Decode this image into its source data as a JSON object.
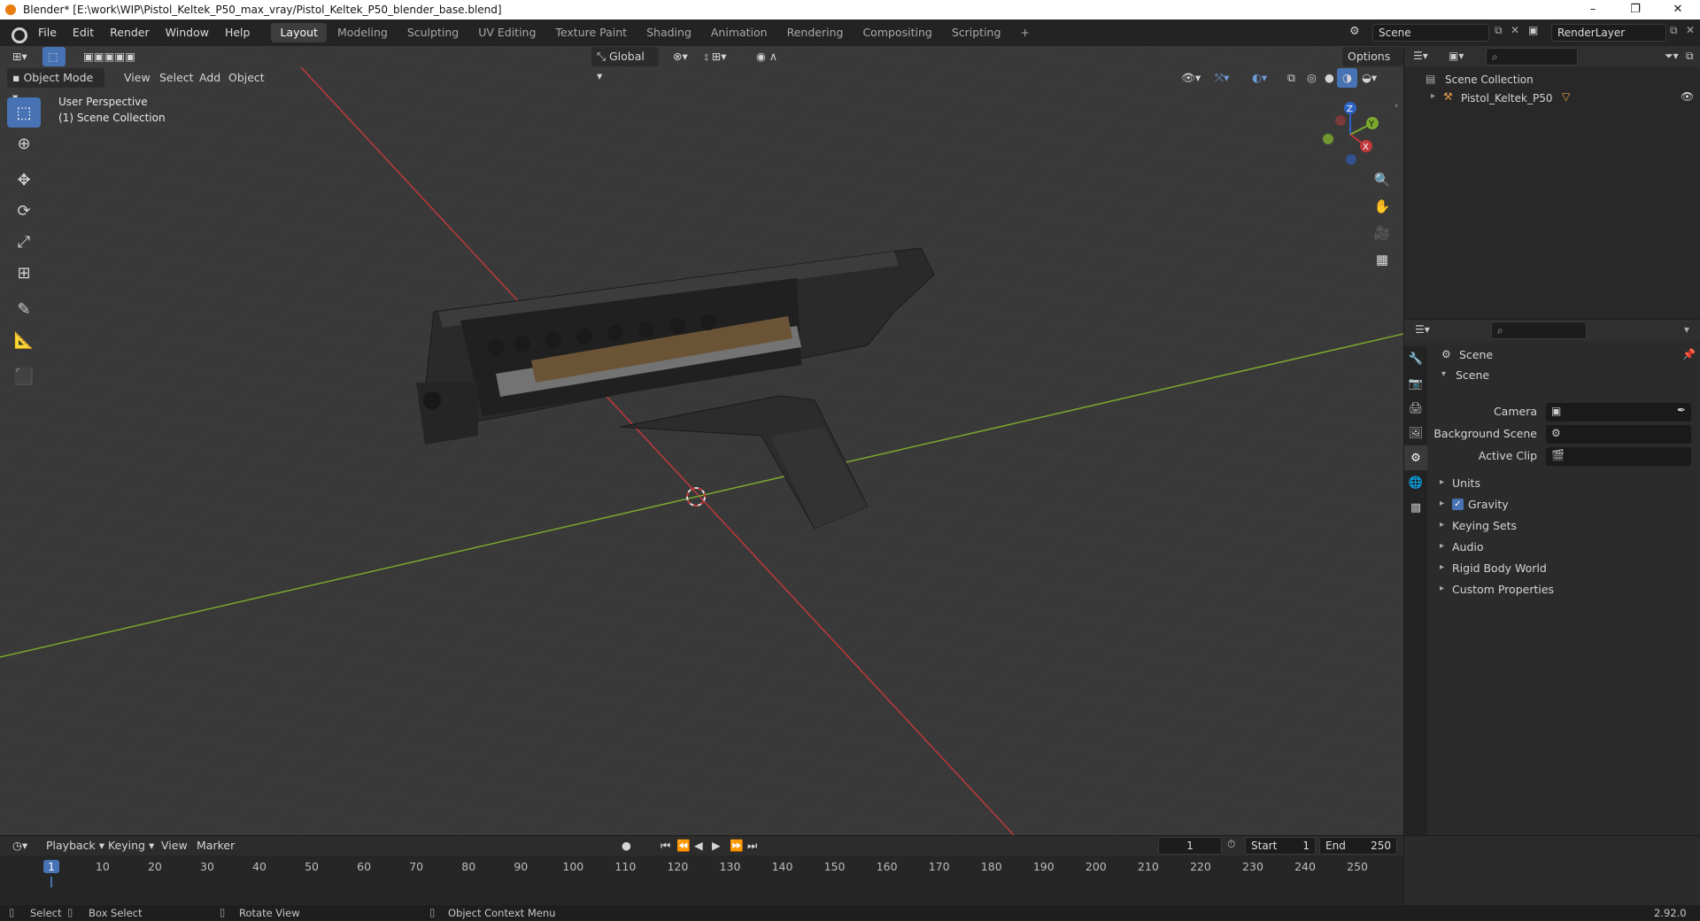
{
  "window": {
    "title": "Blender* [E:\\work\\WIP\\Pistol_Keltek_P50_max_vray/Pistol_Keltek_P50_blender_base.blend]",
    "minimize": "–",
    "restore": "❐",
    "close": "✕"
  },
  "menus": [
    "File",
    "Edit",
    "Render",
    "Window",
    "Help"
  ],
  "workspaces": [
    "Layout",
    "Modeling",
    "Sculpting",
    "UV Editing",
    "Texture Paint",
    "Shading",
    "Animation",
    "Rendering",
    "Compositing",
    "Scripting"
  ],
  "workspace_add": "+",
  "active_workspace": "Layout",
  "scene_field": "Scene",
  "renderlayer_field": "RenderLayer",
  "viewport": {
    "mode": "Object Mode",
    "menus": [
      "View",
      "Select",
      "Add",
      "Object"
    ],
    "orientation": "Global",
    "options": "Options",
    "overlay_line1": "User Perspective",
    "overlay_line2": "(1) Scene Collection",
    "gizmo_axes": {
      "x": "X",
      "y": "Y",
      "z": "Z"
    },
    "colors": {
      "x_axis": "#c0393b",
      "y_axis": "#7aa82e",
      "grid": "#444444",
      "background": "#393939"
    }
  },
  "outliner": {
    "root": "Scene Collection",
    "items": [
      {
        "label": "Pistol_Keltek_P50"
      }
    ]
  },
  "properties": {
    "header": "Scene",
    "panel": "Scene",
    "fields": [
      {
        "label": "Camera"
      },
      {
        "label": "Background Scene"
      },
      {
        "label": "Active Clip"
      }
    ],
    "sections": [
      {
        "label": "Units",
        "checkbox": false
      },
      {
        "label": "Gravity",
        "checkbox": true
      },
      {
        "label": "Keying Sets",
        "checkbox": false
      },
      {
        "label": "Audio",
        "checkbox": false
      },
      {
        "label": "Rigid Body World",
        "checkbox": false
      },
      {
        "label": "Custom Properties",
        "checkbox": false
      }
    ]
  },
  "timeline": {
    "menus": [
      "Playback",
      "Keying",
      "View",
      "Marker"
    ],
    "current_frame": "1",
    "start_label": "Start",
    "start": "1",
    "end_label": "End",
    "end": "250",
    "ticks": [
      "1",
      "10",
      "20",
      "30",
      "40",
      "50",
      "60",
      "70",
      "80",
      "90",
      "100",
      "110",
      "120",
      "130",
      "140",
      "150",
      "160",
      "170",
      "180",
      "190",
      "200",
      "210",
      "220",
      "230",
      "240",
      "250"
    ]
  },
  "statusbar": {
    "items": [
      "Select",
      "Box Select",
      "Rotate View",
      "Object Context Menu"
    ],
    "version": "2.92.0"
  },
  "accent": "#4772b3"
}
